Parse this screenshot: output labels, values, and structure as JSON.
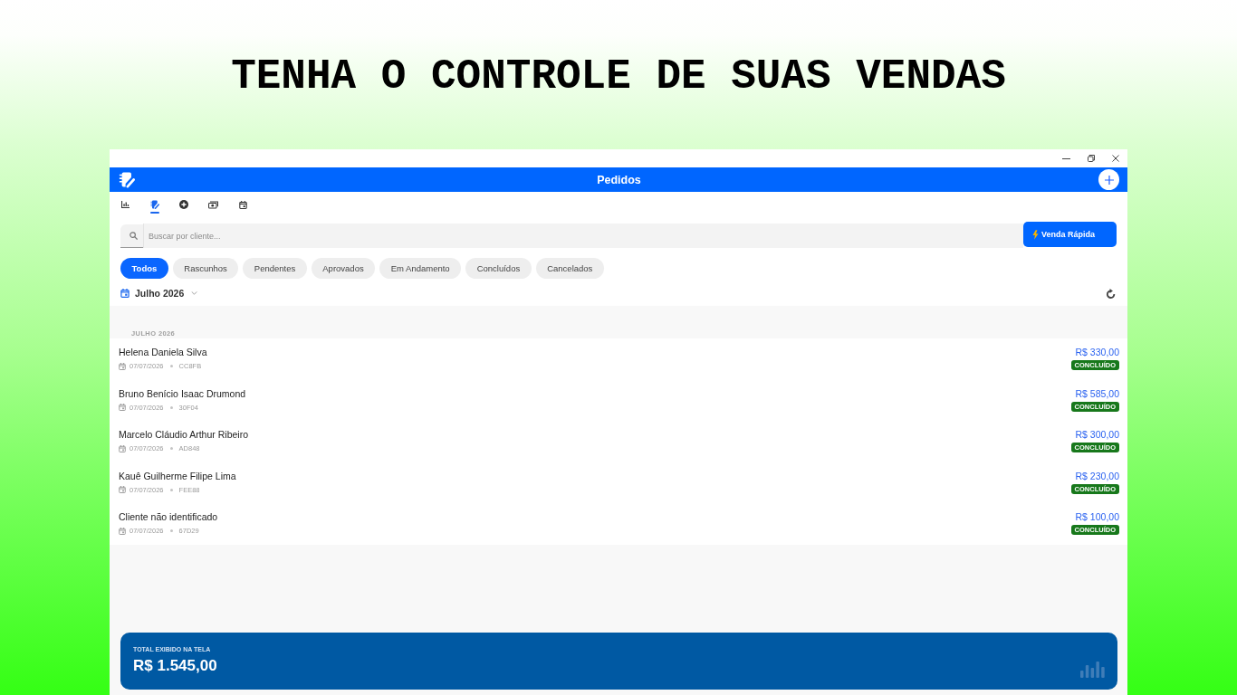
{
  "headline": "TENHA O CONTROLE DE SUAS VENDAS",
  "window": {
    "header": {
      "title": "Pedidos"
    },
    "nav_tabs": [
      {
        "selected": false
      },
      {
        "selected": true
      },
      {
        "selected": false
      },
      {
        "selected": false
      },
      {
        "selected": false
      }
    ],
    "search": {
      "placeholder": "Buscar por cliente..."
    },
    "quick_sale_button": "Venda Rápida",
    "filters": [
      {
        "label": "Todos",
        "selected": true
      },
      {
        "label": "Rascunhos",
        "selected": false
      },
      {
        "label": "Pendentes",
        "selected": false
      },
      {
        "label": "Aprovados",
        "selected": false
      },
      {
        "label": "Em Andamento",
        "selected": false
      },
      {
        "label": "Concluídos",
        "selected": false
      },
      {
        "label": "Cancelados",
        "selected": false
      }
    ],
    "month_picker": {
      "label": "Julho 2026"
    },
    "orders_section": {
      "heading": "JULHO 2026",
      "orders": [
        {
          "customer": "Helena Daniela Silva",
          "date": "07/07/2026",
          "code": "CC8FB",
          "amount": "R$ 330,00",
          "status": {
            "label": "CONCLUÍDO",
            "color": "#17781b"
          }
        },
        {
          "customer": "Bruno Benício Isaac Drumond",
          "date": "07/07/2026",
          "code": "30F04",
          "amount": "R$ 585,00",
          "status": {
            "label": "CONCLUÍDO",
            "color": "#17781b"
          }
        },
        {
          "customer": "Marcelo Cláudio Arthur Ribeiro",
          "date": "07/07/2026",
          "code": "AD848",
          "amount": "R$ 300,00",
          "status": {
            "label": "CONCLUÍDO",
            "color": "#17781b"
          }
        },
        {
          "customer": "Kauê Guilherme Filipe Lima",
          "date": "07/07/2026",
          "code": "FEE88",
          "amount": "R$ 230,00",
          "status": {
            "label": "CONCLUÍDO",
            "color": "#17781b"
          }
        },
        {
          "customer": "Cliente não identificado",
          "date": "07/07/2026",
          "code": "67D29",
          "amount": "R$ 100,00",
          "status": {
            "label": "CONCLUÍDO",
            "color": "#17781b"
          }
        }
      ]
    },
    "total": {
      "label": "TOTAL EXIBIDO NA TELA",
      "value": "R$ 1.545,00"
    }
  }
}
